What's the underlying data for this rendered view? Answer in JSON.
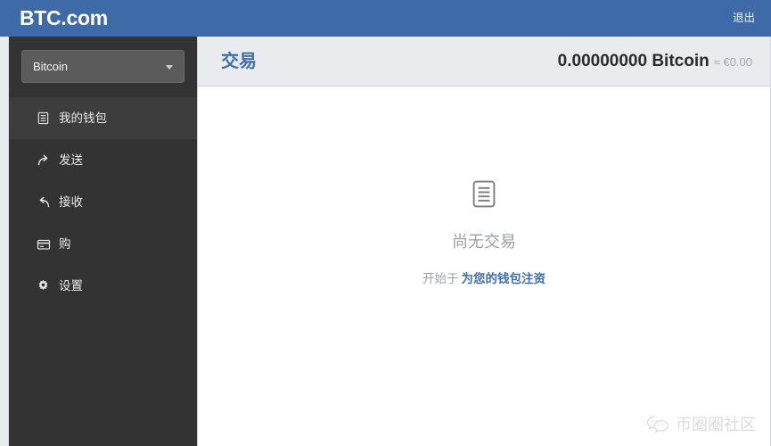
{
  "topbar": {
    "brand": "BTC.com",
    "logout_label": "退出"
  },
  "sidebar": {
    "coin_select": {
      "selected": "Bitcoin",
      "options": [
        "Bitcoin"
      ]
    },
    "items": [
      {
        "label": "我的钱包",
        "icon": "wallet-list-icon",
        "active": true
      },
      {
        "label": "发送",
        "icon": "send-arrow-icon",
        "active": false
      },
      {
        "label": "接收",
        "icon": "receive-arrow-icon",
        "active": false
      },
      {
        "label": "购",
        "icon": "credit-card-icon",
        "active": false
      },
      {
        "label": "设置",
        "icon": "gear-icon",
        "active": false
      }
    ]
  },
  "content": {
    "page_title": "交易",
    "balance": {
      "amount": "0.00000000 Bitcoin",
      "approx": "≈ €0.00"
    },
    "empty_state": {
      "icon": "document-list-icon",
      "title": "尚无交易",
      "prefix": "开始于",
      "link_label": "为您的钱包注资"
    }
  },
  "watermark": {
    "icon": "wechat-icon",
    "text": "币圈圈社区"
  },
  "colors": {
    "topbar_blue": "#3e6ba8",
    "sidebar_dark": "#333333",
    "sidebar_active": "#3d3d3d",
    "accent_blue": "#3f6fab",
    "panel_gray": "#e9ebef",
    "muted_text": "#9aa0a8"
  }
}
